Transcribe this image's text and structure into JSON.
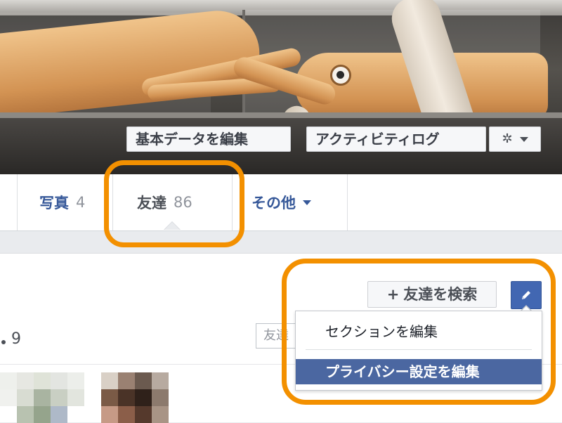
{
  "cover": {
    "edit_profile_label": "基本データを編集",
    "activity_log_label": "アクティビティログ",
    "settings_icon": "gear-icon"
  },
  "tabs": [
    {
      "label": "写真",
      "count": "4"
    },
    {
      "label": "友達",
      "count": "86",
      "active": true
    },
    {
      "label": "その他"
    }
  ],
  "friends_panel": {
    "find_friends_plus": "+",
    "find_friends_label": "友達を検索",
    "friend_count": "9",
    "filter_placeholder": "友達",
    "edit_icon": "pencil-icon",
    "menu": {
      "items": [
        "セクションを編集",
        "プライバシー設定を編集"
      ],
      "highlighted_index": 1
    }
  },
  "colors": {
    "highlight": "#f39000",
    "link": "#365899",
    "menu_selected": "#4b67a1"
  }
}
